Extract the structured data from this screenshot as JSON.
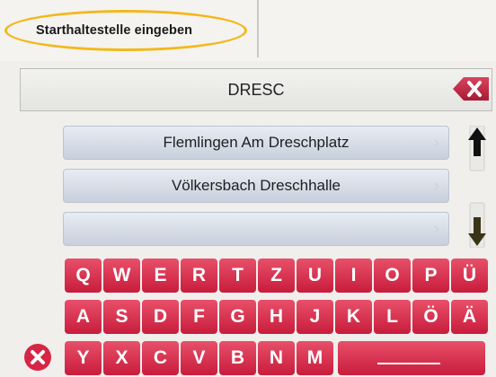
{
  "header": {
    "title": "Starthaltestelle eingeben"
  },
  "search": {
    "value": "DRESC"
  },
  "results": [
    {
      "label": "Flemlingen Am Dreschplatz"
    },
    {
      "label": "Völkersbach Dreschhalle"
    },
    {
      "label": ""
    }
  ],
  "keyboard": {
    "row1": [
      "Q",
      "W",
      "E",
      "R",
      "T",
      "Z",
      "U",
      "I",
      "O",
      "P",
      "Ü"
    ],
    "row2": [
      "A",
      "S",
      "D",
      "F",
      "G",
      "H",
      "J",
      "K",
      "L",
      "Ö",
      "Ä"
    ],
    "row3": [
      "Y",
      "X",
      "C",
      "V",
      "B",
      "N",
      "M"
    ]
  },
  "icons": {
    "clear": "backspace-x-icon",
    "close": "close-circle-icon",
    "scroll_up": "arrow-up-icon",
    "scroll_down": "arrow-down-icon",
    "chevron": "chevron-right-icon"
  },
  "colors": {
    "key": "#d72645",
    "highlight": "#f3b81c",
    "list_item": "#d3dae5",
    "arrow_up": "#111111",
    "arrow_down": "#3a3418"
  }
}
